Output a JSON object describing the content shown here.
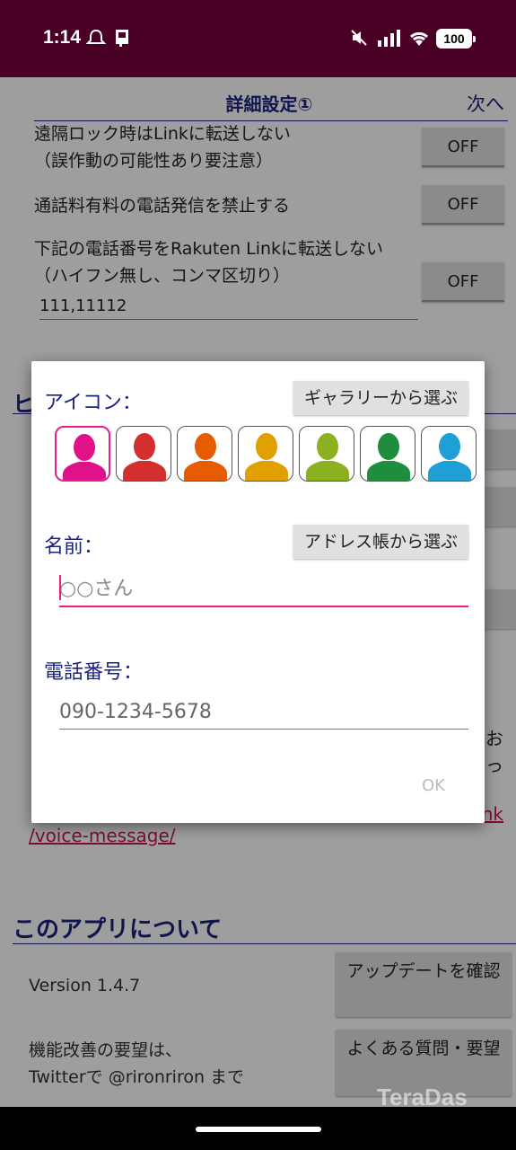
{
  "status_bar": {
    "time": "1:14",
    "battery": "100",
    "icons": [
      "bell-badge-icon",
      "device-icon",
      "mute-icon",
      "signal-icon",
      "wifi-icon",
      "battery-icon"
    ]
  },
  "advanced": {
    "title": "詳細設定①",
    "next": "次へ",
    "rows": [
      {
        "line1": "遠隔ロック時はLinkに転送しない",
        "line2": "（誤作動の可能性あり要注意）",
        "toggle": "OFF"
      },
      {
        "line1": "通話料有料の電話発信を禁止する",
        "toggle": "OFF"
      },
      {
        "line1": "下記の電話番号をRakuten Linkに転送しない",
        "line2": "（ハイフン無し、コンマ区切り）",
        "toggle": "OFF",
        "value": "111,11112"
      }
    ]
  },
  "hint": {
    "heading_fragment": "ヒ",
    "link_start": "/voice-message/",
    "link_end": "nk",
    "char1": "お",
    "char2": "っ"
  },
  "about": {
    "heading": "このアプリについて",
    "version": "Version 1.4.7",
    "request_line1": "機能改善の要望は、",
    "request_line2": "Twitterで @rironriron まで",
    "update_button": "アップデートを確認",
    "faq_button": "よくある質問・要望"
  },
  "dialog": {
    "icon_label": "アイコン：",
    "gallery_button": "ギャラリーから選ぶ",
    "avatar_colors": [
      "#e0128a",
      "#d32f2f",
      "#e65c00",
      "#e0a000",
      "#8bb020",
      "#1e8e3e",
      "#1e9fd6"
    ],
    "selected_avatar": 0,
    "name_label": "名前：",
    "address_button": "アドレス帳から選ぶ",
    "name_placeholder": "○○さん",
    "phone_label": "電話番号：",
    "phone_placeholder": "090-1234-5678",
    "ok": "OK"
  },
  "watermark": "TeraDas"
}
